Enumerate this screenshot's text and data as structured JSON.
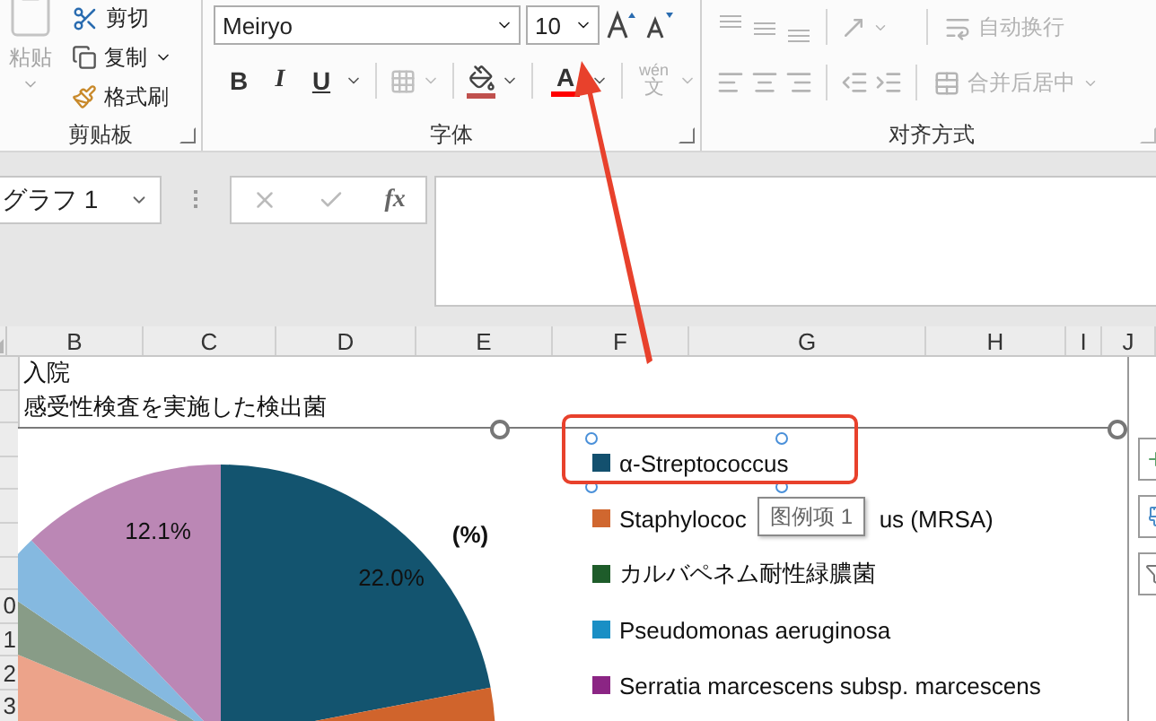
{
  "ribbon": {
    "clipboard": {
      "paste": "粘贴",
      "items": [
        {
          "kind": "cut",
          "label": "剪切"
        },
        {
          "kind": "copy",
          "label": "复制"
        },
        {
          "kind": "painter",
          "label": "格式刷"
        }
      ],
      "label": "剪贴板"
    },
    "font": {
      "name": "Meiryo",
      "size": "10",
      "bold": "B",
      "italic": "I",
      "underline": "U",
      "font_color": "A",
      "phonetic_top": "wén",
      "phonetic_bottom": "文",
      "label": "字体"
    },
    "alignment": {
      "wrap": "自动换行",
      "merge": "合并后居中",
      "label": "对齐方式"
    }
  },
  "name_box": "グラフ 1",
  "function_label": "fx",
  "columns": [
    "B",
    "C",
    "D",
    "E",
    "F",
    "G",
    "H",
    "I",
    "J"
  ],
  "cells": [
    "入院",
    "感受性検査を実施した検出菌"
  ],
  "row_headers": [
    "0",
    "1",
    "2",
    "3"
  ],
  "chart": {
    "unit": "(%)",
    "data_labels": [
      "22.0%",
      "12.1%"
    ],
    "legend": [
      {
        "label": "α-Streptococcus",
        "color": "#13506e",
        "selected": true
      },
      {
        "label": "Staphylococ",
        "label_tail": "us (MRSA)",
        "color": "#d0672f",
        "selected": false
      },
      {
        "label": "カルバペネム耐性緑膿菌",
        "color": "#1e5c2a",
        "selected": false
      },
      {
        "label": "Pseudomonas aeruginosa",
        "color": "#1a8fc5",
        "selected": false
      },
      {
        "label": "Serratia marcescens subsp. marcescens",
        "color": "#8b2584",
        "selected": false
      }
    ]
  },
  "tooltip": "图例项 1"
}
